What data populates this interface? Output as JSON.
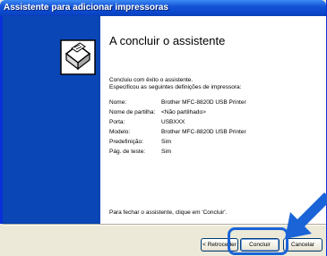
{
  "window": {
    "title": "Assistente para adicionar impressoras"
  },
  "content": {
    "heading": "A concluir o assistente",
    "intro_line1": "Concluiu com êxito o assistente.",
    "intro_line2": "Especificou as seguintes definições de impressora:",
    "settings": [
      {
        "label": "Nome:",
        "value": "Brother MFC-8820D USB Printer"
      },
      {
        "label": "Nome de partilha:",
        "value": "<Não partilhado>"
      },
      {
        "label": "Porta:",
        "value": "USBXXX"
      },
      {
        "label": "Modelo:",
        "value": "Brother MFC-8820D USB Printer"
      },
      {
        "label": "Predefinição:",
        "value": "Sim"
      },
      {
        "label": "Pág. de teste:",
        "value": "Sim"
      }
    ],
    "footer": "Para fechar o assistente, clique em 'Concluir'."
  },
  "buttons": {
    "back": "< Retroceder",
    "finish": "Concluir",
    "cancel": "Cancelar"
  },
  "icons": {
    "wizard_image": "printer-icon",
    "callout": "arrow-pointer-icon"
  },
  "colors": {
    "side_panel": "#0a46b5",
    "titlebar": "#0a46cc",
    "highlight": "#1a64d8"
  }
}
